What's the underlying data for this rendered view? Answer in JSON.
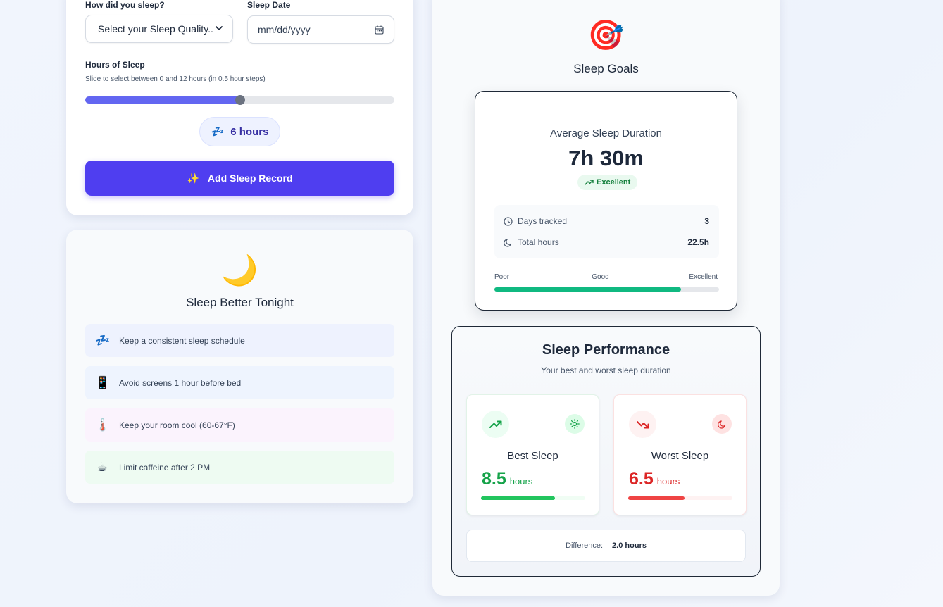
{
  "form": {
    "quality_label": "How did you sleep?",
    "quality_value": "Select your Sleep Quality..",
    "date_label": "Sleep Date",
    "date_placeholder": "mm/dd/yyyy",
    "hours_label": "Hours of Sleep",
    "hours_hint": "Slide to select between 0 and 12 hours (in 0.5 hour steps)",
    "slider": {
      "min": 0,
      "max": 12,
      "value": 6
    },
    "hours_emoji": "💤",
    "hours_display": "6 hours",
    "add_emoji": "✨",
    "add_button": "Add Sleep Record"
  },
  "tips": {
    "emoji": "🌙",
    "title": "Sleep Better Tonight",
    "items": [
      {
        "emoji": "💤",
        "text": "Keep a consistent sleep schedule",
        "color": "#eef2fe"
      },
      {
        "emoji": "📱",
        "text": "Avoid screens 1 hour before bed",
        "color": "#eef4fe"
      },
      {
        "emoji": "🌡️",
        "text": "Keep your room cool (60-67°F)",
        "color": "#fbf3fd"
      },
      {
        "emoji": "☕",
        "text": "Limit caffeine after 2 PM",
        "color": "#eefbf2"
      }
    ]
  },
  "goals": {
    "emoji": "🎯",
    "title": "Sleep Goals",
    "avg_label": "Average Sleep Duration",
    "avg_value": "7h 30m",
    "rating": "Excellent",
    "days_label": "Days tracked",
    "days_value": "3",
    "total_label": "Total hours",
    "total_value": "22.5h",
    "scale": {
      "poor": "Poor",
      "good": "Good",
      "excellent": "Excellent"
    },
    "progress_fraction": 0.83
  },
  "performance": {
    "title": "Sleep Performance",
    "subtitle": "Your best and worst sleep duration",
    "best": {
      "title": "Best Sleep",
      "value": "8.5",
      "unit": "hours",
      "fraction": 0.708,
      "color": "#16a34a"
    },
    "worst": {
      "title": "Worst Sleep",
      "value": "6.5",
      "unit": "hours",
      "fraction": 0.54,
      "color": "#dc2626"
    },
    "difference_label": "Difference:",
    "difference_value": "2.0 hours"
  }
}
